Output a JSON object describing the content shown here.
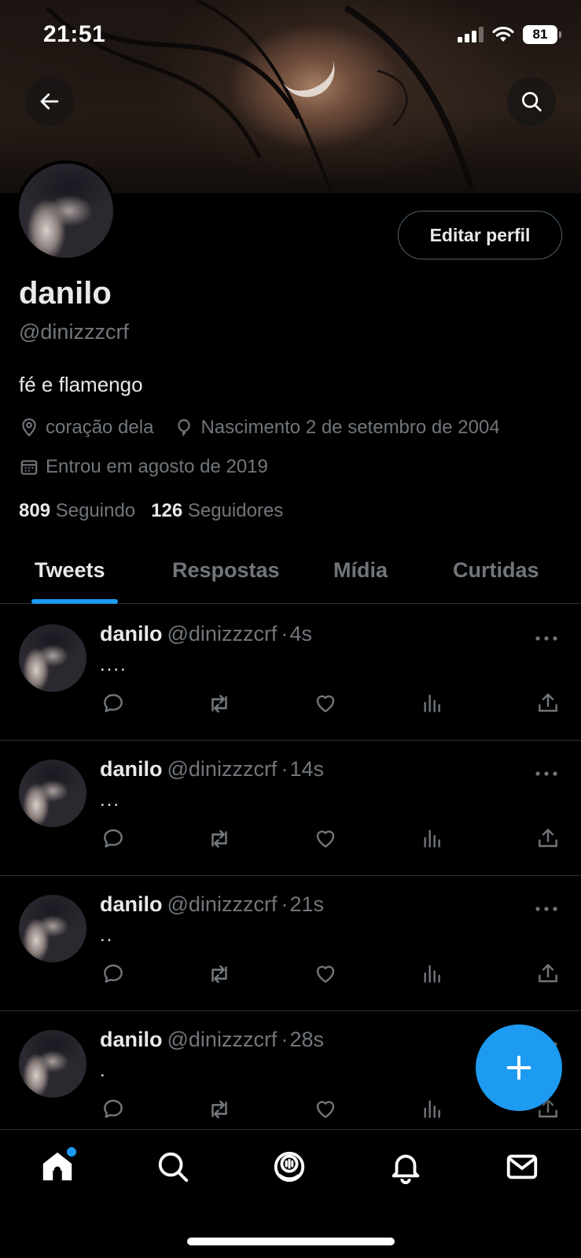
{
  "status_bar": {
    "time": "21:51",
    "battery": "81"
  },
  "header": {
    "back_icon": "arrow-left-icon",
    "search_icon": "search-icon"
  },
  "profile": {
    "name": "danilo",
    "handle": "@dinizzzcrf",
    "bio": "fé e flamengo",
    "edit_button": "Editar perfil",
    "location": "coração dela",
    "birth": "Nascimento 2 de setembro de 2004",
    "joined": "Entrou em agosto de 2019",
    "following_count": "809",
    "following_label": "Seguindo",
    "followers_count": "126",
    "followers_label": "Seguidores"
  },
  "tabs": [
    {
      "label": "Tweets",
      "active": true
    },
    {
      "label": "Respostas",
      "active": false
    },
    {
      "label": "Mídia",
      "active": false
    },
    {
      "label": "Curtidas",
      "active": false
    }
  ],
  "tweets": [
    {
      "name": "danilo",
      "handle": "@dinizzzcrf",
      "sep": "·",
      "time": "4s",
      "text": "...."
    },
    {
      "name": "danilo",
      "handle": "@dinizzzcrf",
      "sep": "·",
      "time": "14s",
      "text": "..."
    },
    {
      "name": "danilo",
      "handle": "@dinizzzcrf",
      "sep": "·",
      "time": "21s",
      "text": ".."
    },
    {
      "name": "danilo",
      "handle": "@dinizzzcrf",
      "sep": "·",
      "time": "28s",
      "text": "."
    }
  ],
  "colors": {
    "accent": "#1d9bf0",
    "background": "#000000",
    "muted": "#71767b",
    "text": "#e7e9ea"
  },
  "bottom_nav": [
    "home-icon",
    "search-icon",
    "spaces-icon",
    "notifications-icon",
    "messages-icon"
  ]
}
